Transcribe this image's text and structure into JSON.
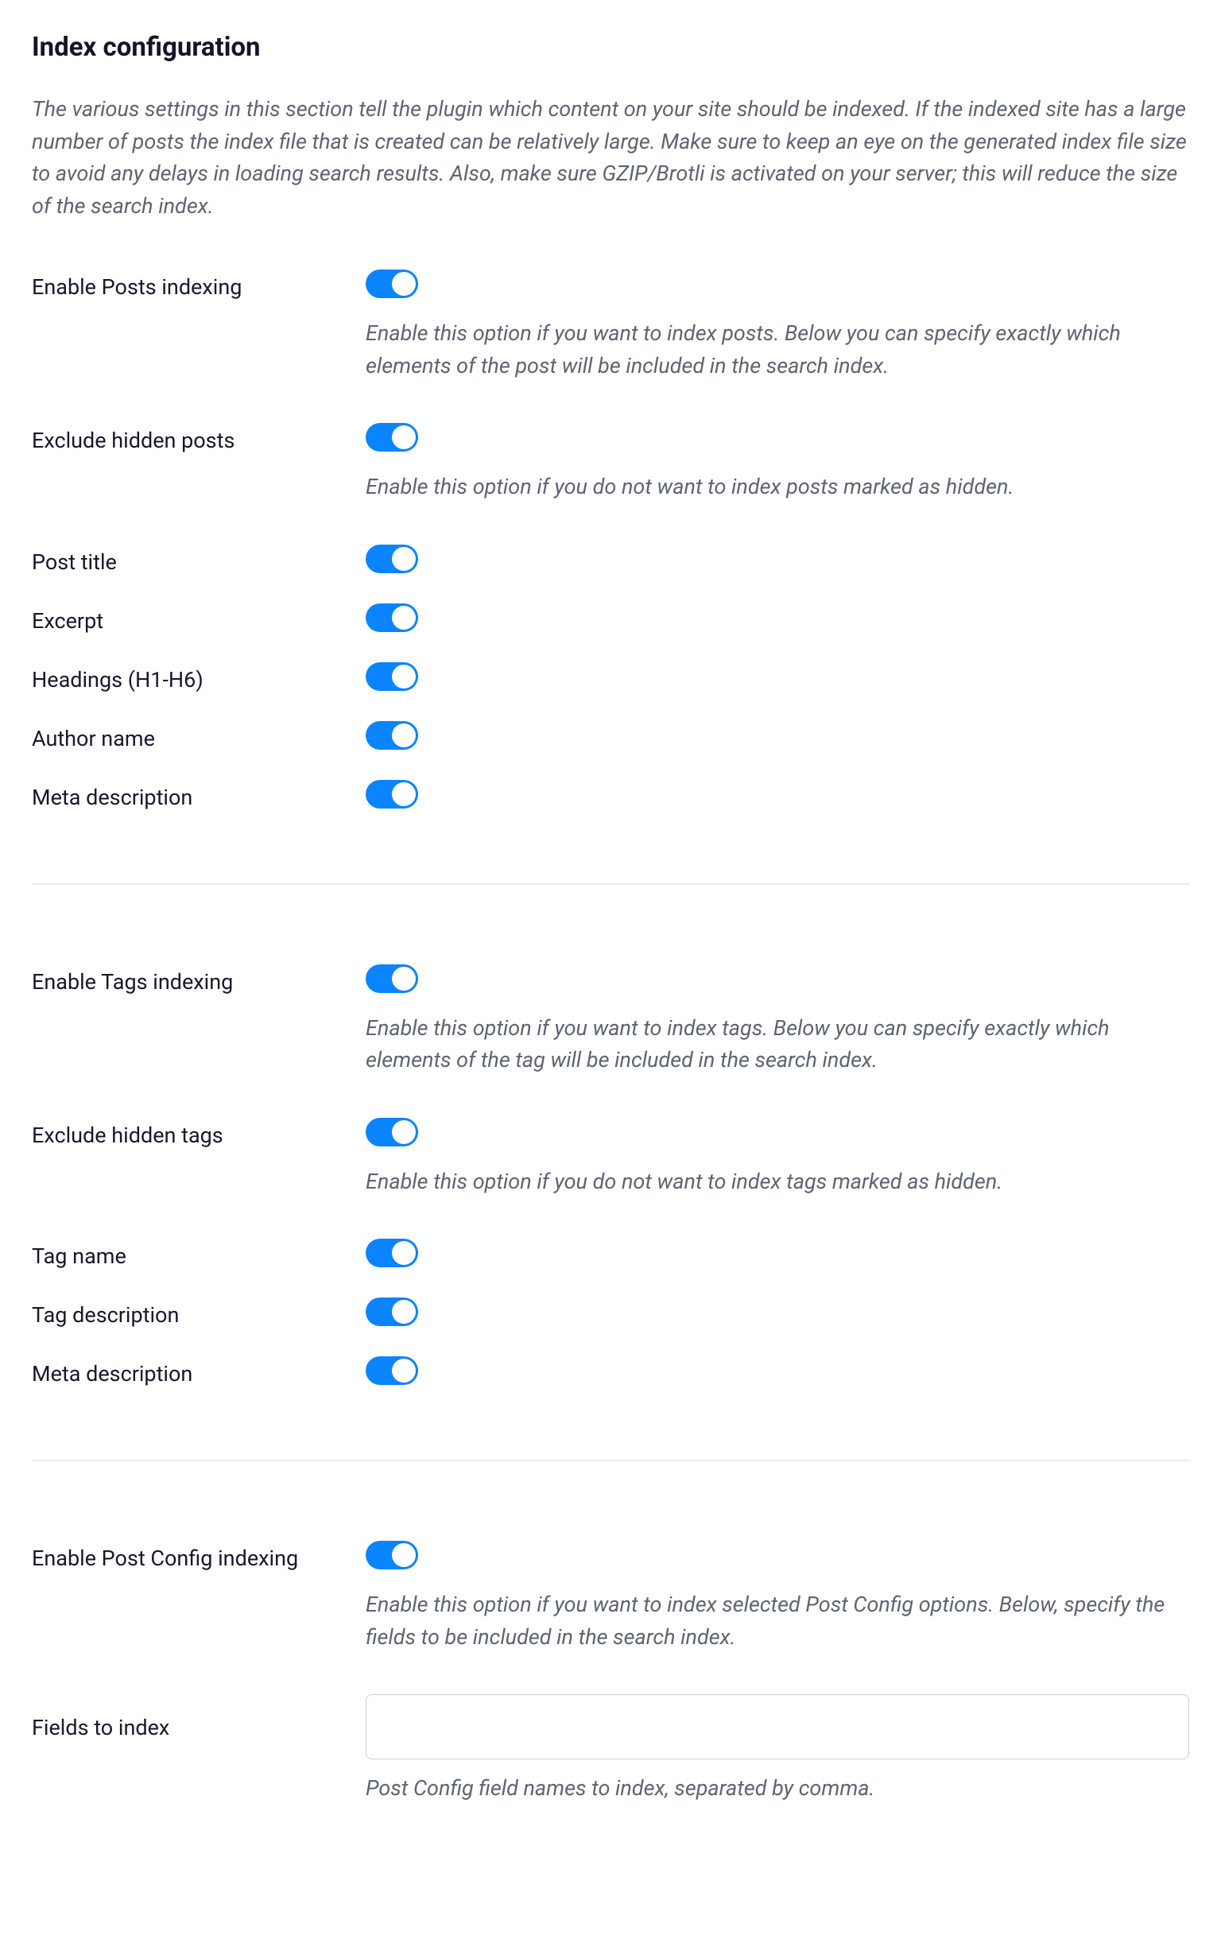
{
  "section": {
    "title": "Index configuration",
    "description": "The various settings in this section tell the plugin which content on your site should be indexed. If the indexed site has a large number of posts the index file that is created can be relatively large. Make sure to keep an eye on the generated index file size to avoid any delays in loading search results. Also, make sure GZIP/Brotli is activated on your server; this will reduce the size of the search index."
  },
  "posts": {
    "enable_label": "Enable Posts indexing",
    "enable_desc": "Enable this option if you want to index posts. Below you can specify exactly which elements of the post will be included in the search index.",
    "exclude_label": "Exclude hidden posts",
    "exclude_desc": "Enable this option if you do not want to index posts marked as hidden.",
    "title_label": "Post title",
    "excerpt_label": "Excerpt",
    "headings_label": "Headings (H1-H6)",
    "author_label": "Author name",
    "meta_label": "Meta description"
  },
  "tags": {
    "enable_label": "Enable Tags indexing",
    "enable_desc": "Enable this option if you want to index tags. Below you can specify exactly which elements of the tag will be included in the search index.",
    "exclude_label": "Exclude hidden tags",
    "exclude_desc": "Enable this option if you do not want to index tags marked as hidden.",
    "name_label": "Tag name",
    "desc_label": "Tag description",
    "meta_label": "Meta description"
  },
  "postconfig": {
    "enable_label": "Enable Post Config indexing",
    "enable_desc": "Enable this option if you want to index selected Post Config options. Below, specify the fields to be included in the search index.",
    "fields_label": "Fields to index",
    "fields_value": "",
    "fields_desc": "Post Config field names to index, separated by comma."
  }
}
